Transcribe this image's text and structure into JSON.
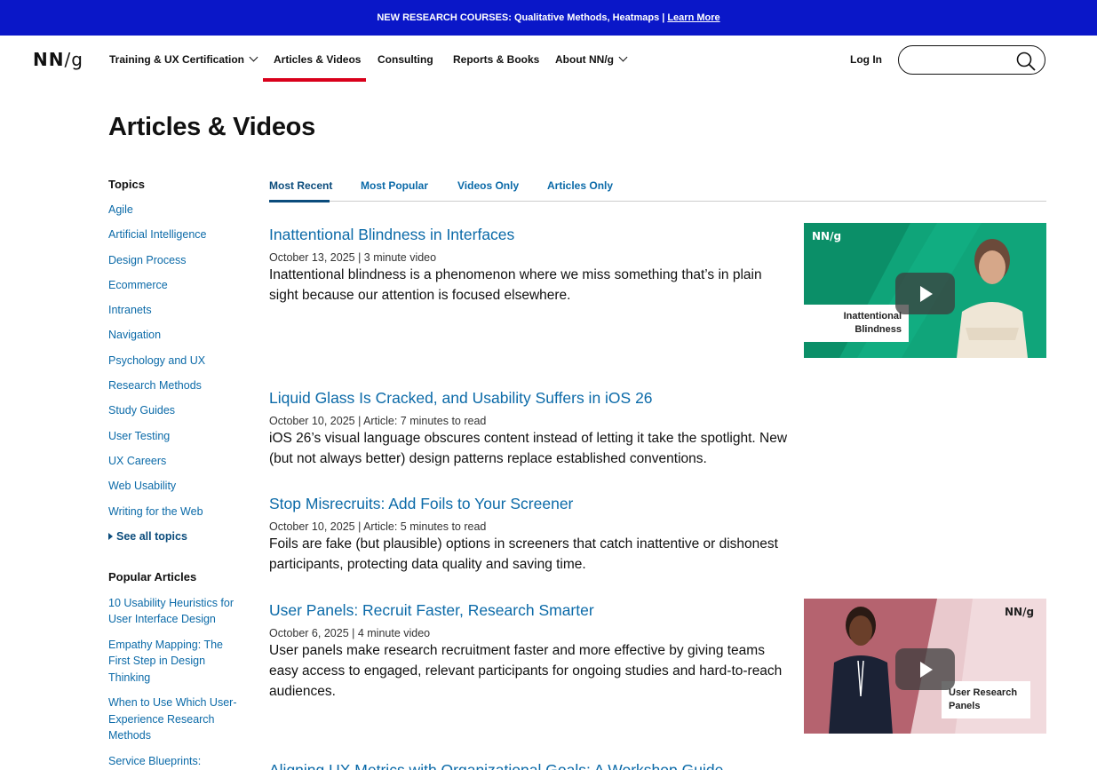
{
  "banner": {
    "text": "NEW RESEARCH COURSES: Qualitative Methods, Heatmaps |",
    "link": "Learn More"
  },
  "logo": {
    "nn": "NN",
    "slash": "/",
    "g": "g"
  },
  "nav": {
    "items": [
      {
        "label": "Training & UX Certification",
        "dropdown": true
      },
      {
        "label": "Articles & Videos",
        "active": true
      },
      {
        "label": "Consulting"
      },
      {
        "label": "Reports & Books"
      },
      {
        "label": "About NN/g",
        "dropdown": true
      }
    ],
    "login": "Log In",
    "search_placeholder": "",
    "accent_color": "#d9001b"
  },
  "page_title": "Articles & Videos",
  "sidebar": {
    "topics_heading": "Topics",
    "topics": [
      "Agile",
      "Artificial Intelligence",
      "Design Process",
      "Ecommerce",
      "Intranets",
      "Navigation",
      "Psychology and UX",
      "Research Methods",
      "Study Guides",
      "User Testing",
      "UX Careers",
      "Web Usability",
      "Writing for the Web"
    ],
    "see_all": "See all topics",
    "popular_heading": "Popular Articles",
    "popular": [
      "10 Usability Heuristics for User Interface Design",
      "Empathy Mapping: The First Step in Design Thinking",
      "When to Use Which User-Experience Research Methods",
      "Service Blueprints:"
    ]
  },
  "tabs": [
    "Most Recent",
    "Most Popular",
    "Videos Only",
    "Articles Only"
  ],
  "articles": [
    {
      "title": "Inattentional Blindness in Interfaces",
      "meta": "October 13, 2025 | 3 minute video",
      "desc": "Inattentional blindness is a phenomenon where we miss something that’s in plain sight because our attention is focused elsewhere.",
      "thumb_caption": "Inattentional Blindness",
      "thumb_logo": "NN/g"
    },
    {
      "title": "Liquid Glass Is Cracked, and Usability Suffers in iOS 26",
      "meta": "October 10, 2025 | Article: 7 minutes to read",
      "desc": "iOS 26’s visual language obscures content instead of letting it take the spotlight. New (but not always better) design patterns replace established conventions."
    },
    {
      "title": "Stop Misrecruits: Add Foils to Your Screener",
      "meta": "October 10, 2025 | Article: 5 minutes to read",
      "desc": "Foils are fake (but plausible) options in screeners that catch inattentive or dishonest participants, protecting data quality and saving time."
    },
    {
      "title": "User Panels: Recruit Faster, Research Smarter",
      "meta": "October 6, 2025 | 4 minute video",
      "desc": "User panels make research recruitment faster and more effective by giving teams easy access to engaged, relevant participants for ongoing studies and hard-to-reach audiences.",
      "thumb_caption": "User Research Panels",
      "thumb_logo": "NN/g"
    },
    {
      "title": "Aligning UX Metrics with Organizational Goals: A Workshop Guide"
    }
  ]
}
